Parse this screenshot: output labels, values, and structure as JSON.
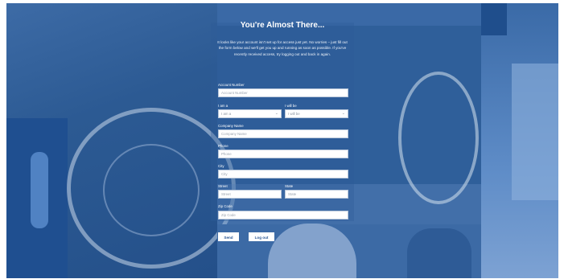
{
  "page": {
    "title": "You're Almost There...",
    "intro": "It looks like your account isn't set up for access just yet. No worries – just fill out the form below and we'll get you up and running as soon as possible. If you've recently received access, try logging out and back in again."
  },
  "form": {
    "account_number": {
      "label": "Account Number",
      "placeholder": "Account Number"
    },
    "i_am_a": {
      "label": "I am a",
      "value": "I am a"
    },
    "i_will_be": {
      "label": "I will be",
      "value": "I will be"
    },
    "company_name": {
      "label": "Company Name",
      "placeholder": "Company Name"
    },
    "phone": {
      "label": "Phone",
      "placeholder": "Phone"
    },
    "city": {
      "label": "City",
      "placeholder": "City"
    },
    "street": {
      "label": "Street",
      "placeholder": "Street"
    },
    "state": {
      "label": "State",
      "placeholder": "State"
    },
    "zip_code": {
      "label": "Zip Code",
      "placeholder": "Zip Code"
    }
  },
  "buttons": {
    "send": "Send",
    "log_out": "Log out"
  },
  "icons": {
    "caret": "chevron-down-icon"
  },
  "colors": {
    "overlay": "#2f5f9a",
    "button_text": "#2a5795",
    "field_bg": "#ffffff"
  }
}
